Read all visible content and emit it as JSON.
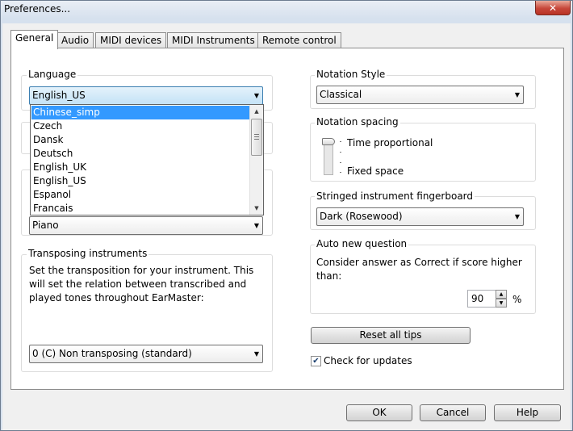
{
  "window": {
    "title": "Preferences...",
    "close_glyph": "✕"
  },
  "tabs": [
    {
      "label": "General",
      "active": true
    },
    {
      "label": "Audio"
    },
    {
      "label": "MIDI devices"
    },
    {
      "label": "MIDI Instruments"
    },
    {
      "label": "Remote control"
    }
  ],
  "language": {
    "label": "Language",
    "value": "English_US",
    "options": [
      "Chinese_simp",
      "Czech",
      "Dansk",
      "Deutsch",
      "English_UK",
      "English_US",
      "Espanol",
      "Francais"
    ],
    "highlighted": "Chinese_simp"
  },
  "instrument": {
    "value": "Piano"
  },
  "transposing": {
    "label": "Transposing instruments",
    "description": "Set the transposition for your instrument. This will set the relation between transcribed and played tones throughout EarMaster:",
    "value": "0 (C) Non transposing (standard)"
  },
  "notation_style": {
    "label": "Notation Style",
    "value": "Classical"
  },
  "notation_spacing": {
    "label": "Notation spacing",
    "top_label": "Time proportional",
    "bottom_label": "Fixed space",
    "position": 0
  },
  "fingerboard": {
    "label": "Stringed instrument fingerboard",
    "value": "Dark (Rosewood)"
  },
  "auto_question": {
    "label": "Auto new question",
    "description": "Consider answer as Correct if score higher than:",
    "value": "90",
    "unit": "%"
  },
  "reset_tips": {
    "label": "Reset all tips"
  },
  "check_updates": {
    "label": "Check for updates",
    "checked": true,
    "check_glyph": "✔"
  },
  "footer": {
    "ok": "OK",
    "cancel": "Cancel",
    "help": "Help"
  },
  "icons": {
    "dropdown": "▼",
    "scroll_up": "▲",
    "scroll_down": "▼",
    "spin_up": "▲",
    "spin_down": "▼"
  }
}
